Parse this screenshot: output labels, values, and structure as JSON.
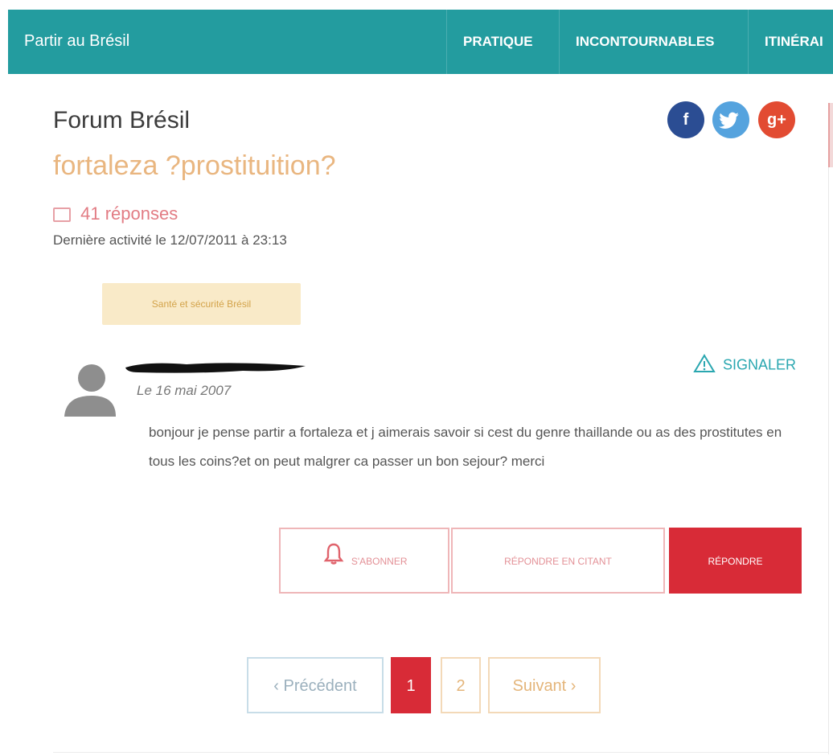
{
  "nav": {
    "brand": "Partir au Brésil",
    "items": [
      "PRATIQUE",
      "INCONTOURNABLES",
      "ITINÉRAI"
    ]
  },
  "header": {
    "forum_label": "Forum Brésil",
    "thread_title": "fortaleza ?prostituition?",
    "replies": "41 réponses",
    "last_activity": "Dernière activité le 12/07/2011 à 23:13",
    "tag": "Santé et sécurité Brésil"
  },
  "social": {
    "facebook": "f",
    "twitter": "t",
    "googleplus": "g+"
  },
  "post": {
    "date": "Le 16 mai 2007",
    "report_label": "SIGNALER",
    "body": "bonjour je pense partir a fortaleza et j aimerais savoir si cest du genre thaillande ou as des prostitutes en tous les coins?et on peut malgrer ca passer un bon sejour? merci"
  },
  "actions": {
    "subscribe": "S'ABONNER",
    "quote_reply": "RÉPONDRE EN CITANT",
    "reply": "RÉPONDRE"
  },
  "pagination": {
    "prev": "‹ Précédent",
    "pages": [
      "1",
      "2"
    ],
    "next": "Suivant ›",
    "current": "1"
  },
  "colors": {
    "nav_bg": "#239c9f",
    "accent_red": "#d82b37",
    "title_orange": "#e9b680",
    "link_teal": "#2aa7b0"
  },
  "icons": [
    "avatar-icon",
    "warning-icon",
    "bell-icon",
    "facebook-icon",
    "twitter-icon",
    "google-plus-icon",
    "replies-icon"
  ]
}
